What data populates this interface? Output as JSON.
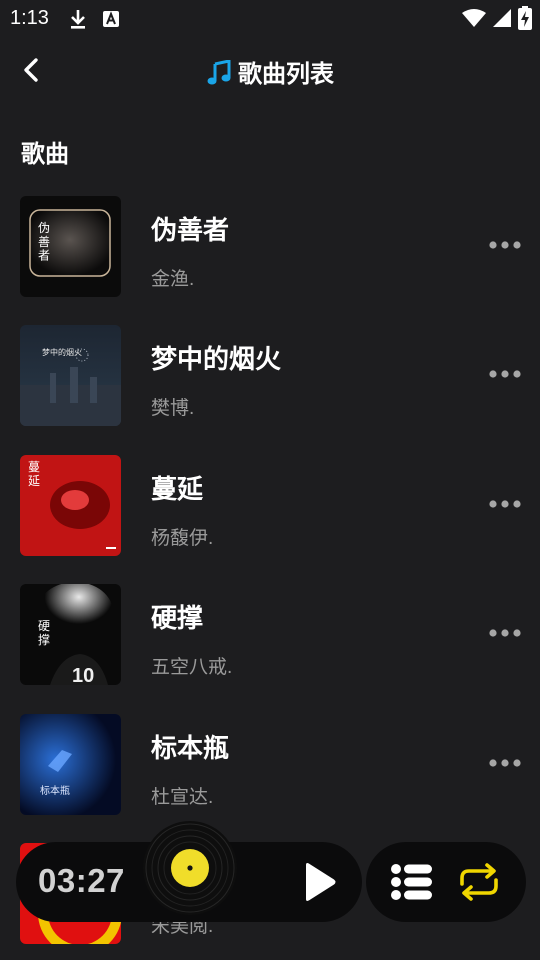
{
  "status": {
    "time": "1:13"
  },
  "header": {
    "title": "歌曲列表"
  },
  "section": {
    "title": "歌曲"
  },
  "songs": [
    {
      "title": "伪善者",
      "artist": "金渔.",
      "cover_text": "伪\n善\n者"
    },
    {
      "title": "梦中的烟火",
      "artist": "樊博.",
      "cover_text": "梦中的烟火"
    },
    {
      "title": "蔓延",
      "artist": "杨馥伊.",
      "cover_text": "蔓\n延"
    },
    {
      "title": "硬撑",
      "artist": "五空八戒.",
      "cover_text": "硬\n撑"
    },
    {
      "title": "标本瓶",
      "artist": "杜宣达.",
      "cover_text": "标本瓶"
    },
    {
      "title": "",
      "artist": "宋美阅."
    }
  ],
  "player": {
    "time": "03:27"
  },
  "colors": {
    "accent_blue": "#1aa5e8",
    "accent_yellow": "#f0d600",
    "background": "#1d1d1f"
  }
}
